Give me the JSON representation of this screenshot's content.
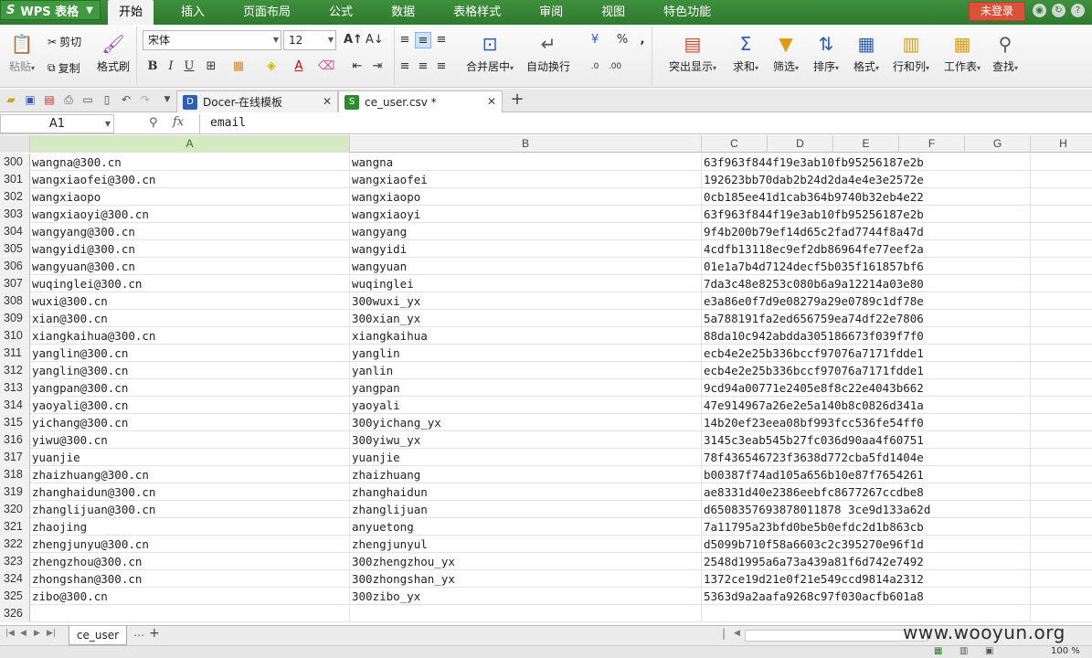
{
  "app": {
    "menu_label": "WPS 表格",
    "logo": "S",
    "login_label": "未登录"
  },
  "menu_tabs": [
    "开始",
    "插入",
    "页面布局",
    "公式",
    "数据",
    "表格样式",
    "审阅",
    "视图",
    "特色功能"
  ],
  "ribbon": {
    "paste": "粘贴",
    "cut": "剪切",
    "copy": "复制",
    "format_painter": "格式刷",
    "font_name": "宋体",
    "font_size": "12",
    "merge_center": "合并居中",
    "wrap_text": "自动换行",
    "highlight": "突出显示",
    "sum": "求和",
    "filter": "筛选",
    "sort": "排序",
    "format": "格式",
    "row_col": "行和列",
    "worksheet": "工作表",
    "find": "查找"
  },
  "doc_tabs": [
    {
      "label": "Docer-在线模板",
      "icon": "D",
      "color": "#2f5fb3"
    },
    {
      "label": "ce_user.csv *",
      "icon": "S",
      "color": "#2f8a2f"
    }
  ],
  "formula_bar": {
    "name_box": "A1",
    "content": "email"
  },
  "columns": [
    "A",
    "B",
    "C",
    "D",
    "E",
    "F",
    "G",
    "H"
  ],
  "rows": [
    {
      "n": "300",
      "a": "wangna@300.cn",
      "b": "wangna",
      "c": "63f963f844f19e3ab10fb95256187e2b"
    },
    {
      "n": "301",
      "a": "wangxiaofei@300.cn",
      "b": "wangxiaofei",
      "c": "192623bb70dab2b24d2da4e4e3e2572e"
    },
    {
      "n": "302",
      "a": "wangxiaopo",
      "b": "wangxiaopo",
      "c": "0cb185ee41d1cab364b9740b32eb4e22"
    },
    {
      "n": "303",
      "a": "wangxiaoyi@300.cn",
      "b": "wangxiaoyi",
      "c": "63f963f844f19e3ab10fb95256187e2b"
    },
    {
      "n": "304",
      "a": "wangyang@300.cn",
      "b": "wangyang",
      "c": "9f4b200b79ef14d65c2fad7744f8a47d"
    },
    {
      "n": "305",
      "a": "wangyidi@300.cn",
      "b": "wangyidi",
      "c": "4cdfb13118ec9ef2db86964fe77eef2a"
    },
    {
      "n": "306",
      "a": "wangyuan@300.cn",
      "b": "wangyuan",
      "c": "01e1a7b4d7124decf5b035f161857bf6"
    },
    {
      "n": "307",
      "a": "wuqinglei@300.cn",
      "b": "wuqinglei",
      "c": "7da3c48e8253c080b6a9a12214a03e80"
    },
    {
      "n": "308",
      "a": "wuxi@300.cn",
      "b": "300wuxi_yx",
      "c": "e3a86e0f7d9e08279a29e0789c1df78e"
    },
    {
      "n": "309",
      "a": "xian@300.cn",
      "b": "300xian_yx",
      "c": "5a788191fa2ed656759ea74df22e7806"
    },
    {
      "n": "310",
      "a": "xiangkaihua@300.cn",
      "b": "xiangkaihua",
      "c": "88da10c942abdda305186673f039f7f0"
    },
    {
      "n": "311",
      "a": "yanglin@300.cn",
      "b": "yanglin",
      "c": "ecb4e2e25b336bccf97076a7171fdde1"
    },
    {
      "n": "312",
      "a": "yanglin@300.cn",
      "b": "yanlin",
      "c": "ecb4e2e25b336bccf97076a7171fdde1"
    },
    {
      "n": "313",
      "a": "yangpan@300.cn",
      "b": "yangpan",
      "c": "9cd94a00771e2405e8f8c22e4043b662"
    },
    {
      "n": "314",
      "a": "yaoyali@300.cn",
      "b": "yaoyali",
      "c": "47e914967a26e2e5a140b8c0826d341a"
    },
    {
      "n": "315",
      "a": "yichang@300.cn",
      "b": "300yichang_yx",
      "c": "14b20ef23eea08bf993fcc536fe54ff0"
    },
    {
      "n": "316",
      "a": "yiwu@300.cn",
      "b": "300yiwu_yx",
      "c": "3145c3eab545b27fc036d90aa4f60751"
    },
    {
      "n": "317",
      "a": "yuanjie",
      "b": "yuanjie",
      "c": "78f436546723f3638d772cba5fd1404e"
    },
    {
      "n": "318",
      "a": "zhaizhuang@300.cn",
      "b": "zhaizhuang",
      "c": "b00387f74ad105a656b10e87f7654261"
    },
    {
      "n": "319",
      "a": "zhanghaidun@300.cn",
      "b": "zhanghaidun",
      "c": "ae8331d40e2386eebfc8677267ccdbe8"
    },
    {
      "n": "320",
      "a": "zhanglijuan@300.cn",
      "b": "zhanglijuan",
      "c": "d6508357693878011878 3ce9d133a62d"
    },
    {
      "n": "321",
      "a": "zhaojing",
      "b": "anyuetong",
      "c": "7a11795a23bfd0be5b0efdc2d1b863cb"
    },
    {
      "n": "322",
      "a": "zhengjunyu@300.cn",
      "b": "zhengjunyul",
      "c": "d5099b710f58a6603c2c395270e96f1d"
    },
    {
      "n": "323",
      "a": "zhengzhou@300.cn",
      "b": "300zhengzhou_yx",
      "c": "2548d1995a6a73a439a81f6d742e7492"
    },
    {
      "n": "324",
      "a": "zhongshan@300.cn",
      "b": "300zhongshan_yx",
      "c": "1372ce19d21e0f21e549ccd9814a2312"
    },
    {
      "n": "325",
      "a": "zibo@300.cn",
      "b": "300zibo_yx",
      "c": "5363d9a2aafa9268c97f030acfb601a8"
    },
    {
      "n": "326",
      "a": "",
      "b": "",
      "c": ""
    }
  ],
  "sheet_tab": "ce_user",
  "status_zoom": "100 %",
  "watermark": "www.wooyun.org"
}
